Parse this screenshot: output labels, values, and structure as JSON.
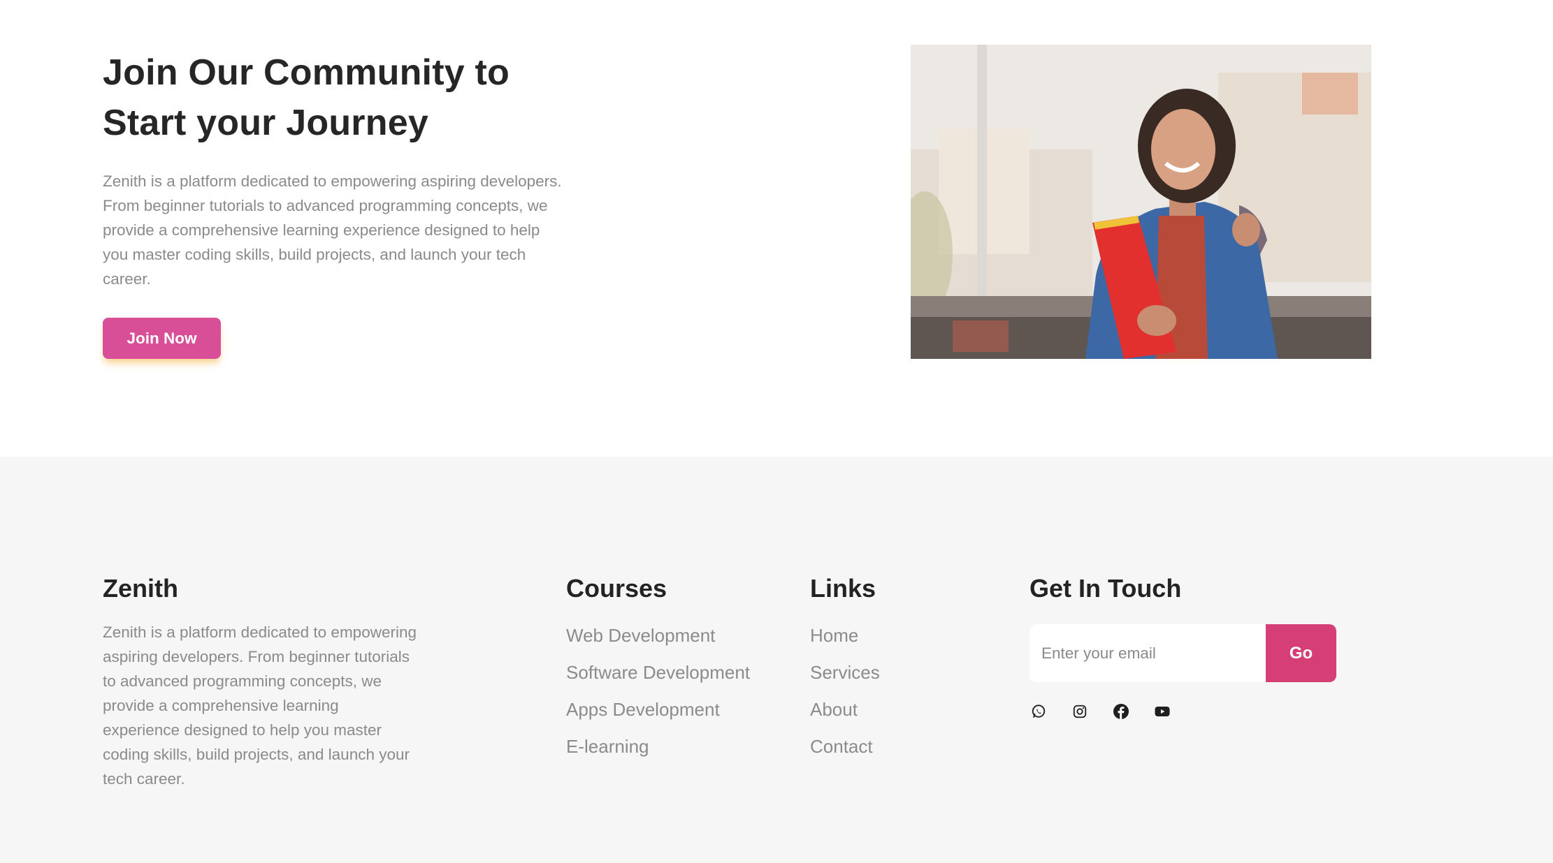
{
  "join": {
    "title_line1": "Join Our Community to",
    "title_line2": "Start your Journey",
    "description": "Zenith is a platform dedicated to empowering aspiring developers. From beginner tutorials to advanced programming concepts, we provide a comprehensive learning experience designed to help you master coding skills, build projects, and launch your tech career.",
    "button_label": "Join Now",
    "image_icon": "student-photo"
  },
  "footer": {
    "brand": {
      "title": "Zenith",
      "description": "Zenith is a platform dedicated to empowering aspiring developers. From beginner tutorials to advanced programming concepts, we provide a comprehensive learning experience designed to help you master coding skills, build projects, and launch your tech career."
    },
    "courses": {
      "title": "Courses",
      "items": [
        "Web Development",
        "Software Development",
        "Apps Development",
        "E-learning"
      ]
    },
    "links": {
      "title": "Links",
      "items": [
        "Home",
        "Services",
        "About",
        "Contact"
      ]
    },
    "touch": {
      "title": "Get In Touch",
      "email_placeholder": "Enter your email",
      "email_value": "",
      "go_label": "Go",
      "socials": [
        "whatsapp-icon",
        "instagram-icon",
        "facebook-icon",
        "youtube-icon"
      ]
    }
  },
  "colors": {
    "accent_pink": "#d94f97",
    "go_button": "#d63f75",
    "footer_bg": "#f6f6f6",
    "button_shadow": "#f5af3c"
  }
}
